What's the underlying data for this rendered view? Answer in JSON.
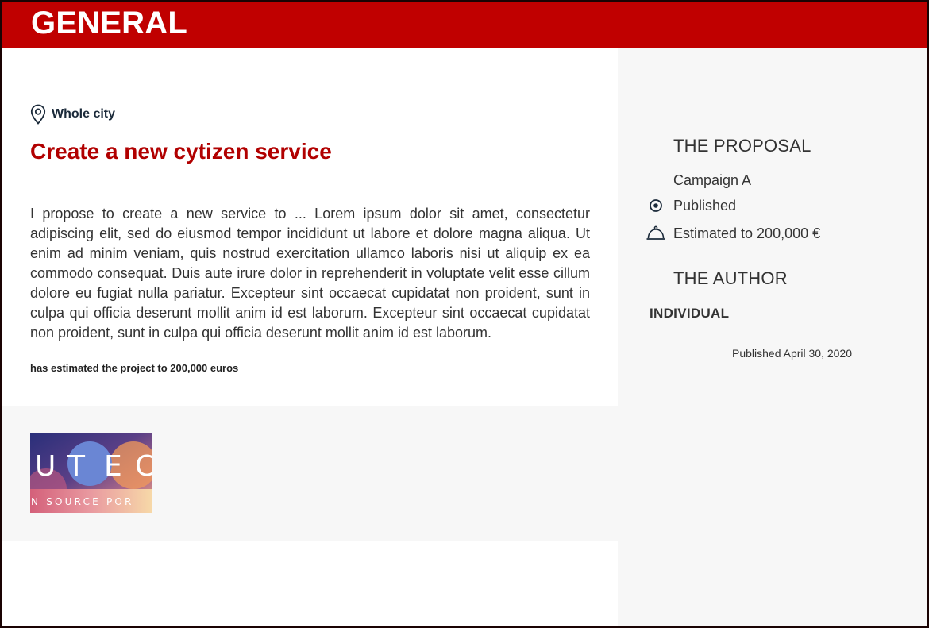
{
  "header": {
    "title": "GENERAL"
  },
  "proposal": {
    "location": "Whole city",
    "title": "Create a new cytizen service",
    "body": "I propose to create a new service to ... Lorem ipsum dolor sit amet, consectetur adipiscing elit, sed do eiusmod tempor incididunt ut labore et dolore magna aliqua. Ut enim ad minim veniam, quis nostrud exercitation ullamco laboris nisi ut aliquip ex ea commodo consequat. Duis aute irure dolor in reprehenderit in voluptate velit esse cillum dolore eu fugiat nulla pariatur. Excepteur sint occaecat cupidatat non proident, sunt in culpa qui officia deserunt mollit anim id est laborum. Excepteur sint occaecat cupidatat non proident, sunt in culpa qui officia deserunt mollit anim id est laborum.",
    "estimate_note": "has estimated the project to 200,000 euros"
  },
  "gallery": {
    "thumbnail_letters": [
      "U",
      "T",
      "E",
      "C"
    ],
    "thumbnail_caption": "N SOURCE POR"
  },
  "sidebar": {
    "proposal_heading": "THE PROPOSAL",
    "campaign": "Campaign A",
    "status": "Published",
    "estimate": "Estimated to 200,000 €",
    "author_heading": "THE AUTHOR",
    "author_type": "INDIVIDUAL",
    "published_date": "Published April 30, 2020"
  },
  "colors": {
    "brand_red": "#c00000",
    "title_red": "#b10000",
    "sidebar_bg": "#f7f7f7",
    "text_dark": "#333333"
  },
  "icons": {
    "location": "map-pin-icon",
    "status": "target-dot-icon",
    "estimate": "service-bell-icon"
  }
}
